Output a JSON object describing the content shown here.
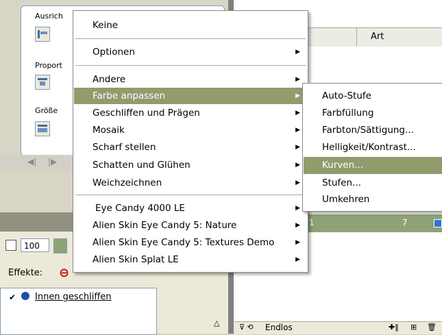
{
  "background": {
    "left_panel": {
      "align_group_label": "Ausrich",
      "proportion_group_label": "Proport",
      "size_group_label": "Größe",
      "zoom_value": "100",
      "effects_label": "Effekte:",
      "effect_item": "Innen geschliffen"
    },
    "right_panel": {
      "column_header": "Art",
      "frame_number_1": "1",
      "frame_number_7": "7",
      "loop_label": "Endlos"
    }
  },
  "context_menu": {
    "items": [
      {
        "label": "Keine",
        "has_submenu": false
      },
      {
        "label": "Optionen",
        "has_submenu": true
      },
      {
        "label": "Andere",
        "has_submenu": true
      },
      {
        "label": "Farbe anpassen",
        "has_submenu": true,
        "highlighted": true
      },
      {
        "label": "Geschliffen und Prägen",
        "has_submenu": true
      },
      {
        "label": "Mosaik",
        "has_submenu": true
      },
      {
        "label": "Scharf stellen",
        "has_submenu": true
      },
      {
        "label": "Schatten und Glühen",
        "has_submenu": true
      },
      {
        "label": "Weichzeichnen",
        "has_submenu": true
      },
      {
        "label": "Eye Candy 4000 LE",
        "has_submenu": true
      },
      {
        "label": "Alien Skin Eye Candy 5: Nature",
        "has_submenu": true
      },
      {
        "label": "Alien Skin Eye Candy 5: Textures Demo",
        "has_submenu": true
      },
      {
        "label": "Alien Skin Splat LE",
        "has_submenu": true
      }
    ]
  },
  "submenu": {
    "items": [
      {
        "label": "Auto-Stufe"
      },
      {
        "label": "Farbfüllung"
      },
      {
        "label": "Farbton/Sättigung..."
      },
      {
        "label": "Helligkeit/Kontrast..."
      },
      {
        "label": "Kurven...",
        "highlighted": true
      },
      {
        "label": "Stufen..."
      },
      {
        "label": "Umkehren"
      }
    ]
  },
  "colors": {
    "highlight": "#909c6c",
    "timeline": "#8fa275"
  }
}
